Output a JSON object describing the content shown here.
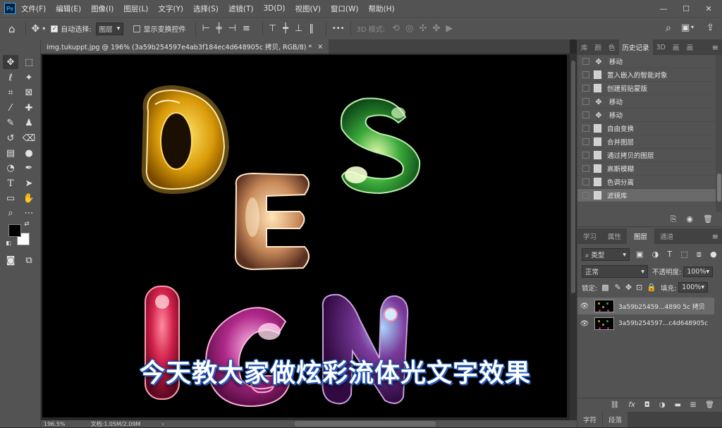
{
  "app": {
    "logo": "Ps"
  },
  "menu": [
    "文件(F)",
    "编辑(E)",
    "图像(I)",
    "图层(L)",
    "文字(Y)",
    "选择(S)",
    "滤镜(T)",
    "3D(D)",
    "视图(V)",
    "窗口(W)",
    "帮助(H)"
  ],
  "options": {
    "auto_select_label": "自动选择:",
    "auto_select_value": "图层",
    "show_transform_label": "显示变换控件",
    "mode_3d_label": "3D 模式:",
    "more": "•••"
  },
  "document": {
    "tab_title": "img.tukuppt.jpg @ 196% (3a59b254597e4ab3f184ec4d648905c 拷贝, RGB/8) *",
    "close": "×"
  },
  "status": {
    "zoom": "196.5%",
    "doc_size": "文档:1.05M/2.09M",
    "arrow": "›"
  },
  "history_panel": {
    "tabs": [
      "库",
      "颜",
      "色",
      "历史记录",
      "3D",
      "画",
      "画"
    ],
    "active_tab": "历史记录",
    "items": [
      {
        "label": "移动",
        "icon": "move"
      },
      {
        "label": "置入嵌入的智能对象",
        "icon": "doc"
      },
      {
        "label": "创建剪贴蒙版",
        "icon": "doc"
      },
      {
        "label": "移动",
        "icon": "move"
      },
      {
        "label": "移动",
        "icon": "move"
      },
      {
        "label": "自由变换",
        "icon": "doc"
      },
      {
        "label": "合并图层",
        "icon": "doc"
      },
      {
        "label": "通过拷贝的图层",
        "icon": "doc"
      },
      {
        "label": "高斯模糊",
        "icon": "doc"
      },
      {
        "label": "色调分离",
        "icon": "doc"
      },
      {
        "label": "滤镜库",
        "icon": "doc",
        "selected": true
      }
    ]
  },
  "layers_panel": {
    "tabs": [
      "学习",
      "属性",
      "图层",
      "通道"
    ],
    "active_tab": "图层",
    "filter_label": "类型",
    "blend_mode": "正常",
    "opacity_label": "不透明度:",
    "opacity_value": "100%",
    "lock_label": "锁定:",
    "fill_label": "填充:",
    "fill_value": "100%",
    "layers": [
      {
        "name": "3a59b25459...4890 5c 拷贝",
        "selected": true
      },
      {
        "name": "3a59b254597...c4d648905c",
        "selected": false
      }
    ],
    "footer_fx": "fx"
  },
  "bottom_tabs": [
    "字符",
    "段落"
  ],
  "subtitle": "今天教大家做炫彩流体光文字效果",
  "colors": {
    "accent": "#31a8ff",
    "panel": "#535353",
    "dark": "#424242",
    "canvas": "#000000",
    "subtitle_outline": "#2a5fc0"
  }
}
